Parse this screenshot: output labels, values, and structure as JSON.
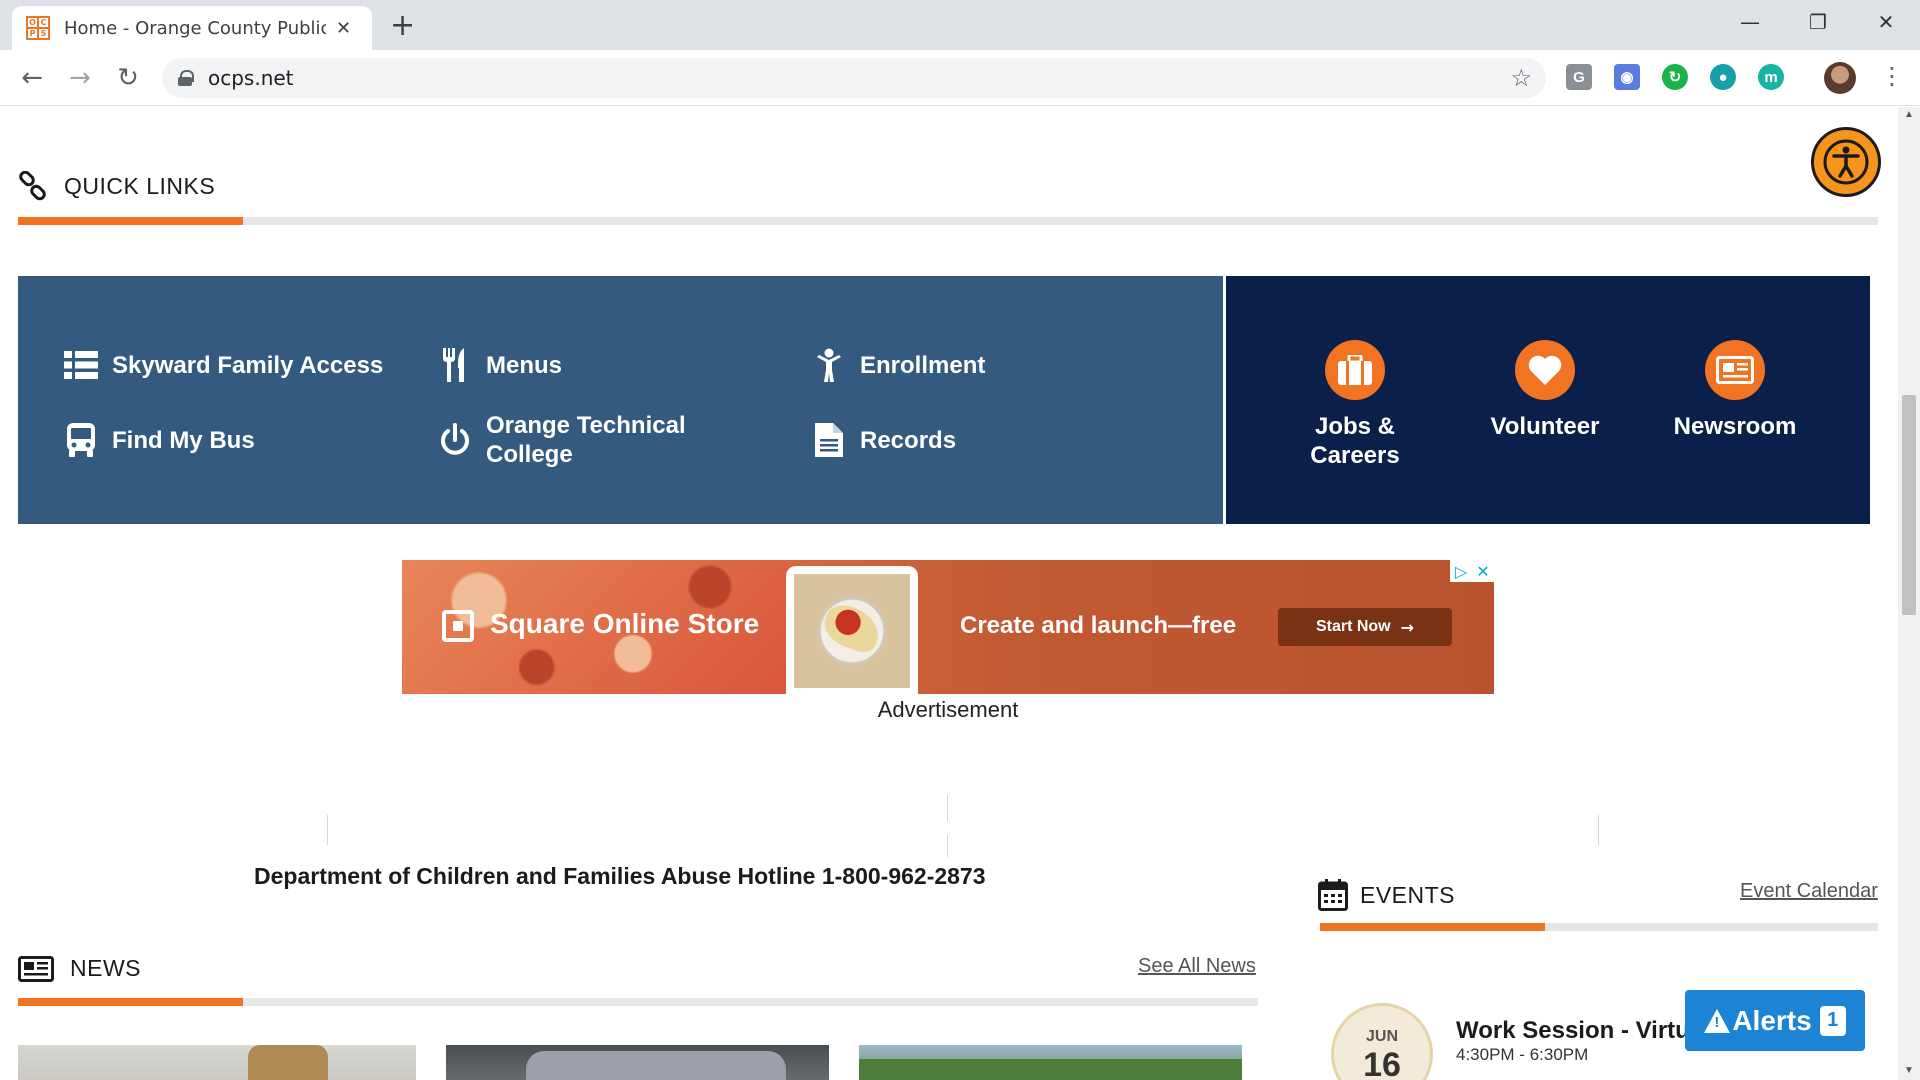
{
  "browser": {
    "tab_title": "Home - Orange County Public Schools",
    "favicon_letters": [
      "O",
      "C",
      "P",
      "S"
    ],
    "url": "ocps.net",
    "window_controls": [
      "minimize",
      "restore",
      "close"
    ],
    "extensions": [
      {
        "name": "grammarly-icon",
        "label": "G",
        "color": "#8a8f96"
      },
      {
        "name": "camera-icon",
        "label": "◉",
        "color": "#5b7be0"
      },
      {
        "name": "sync-icon",
        "label": "↻",
        "color": "#19b24b"
      },
      {
        "name": "blocker-icon",
        "label": "●",
        "color": "#16a0a8"
      },
      {
        "name": "m-icon",
        "label": "m",
        "color": "#17b3a3"
      }
    ]
  },
  "quick_links": {
    "title": "QUICK LINKS",
    "items": [
      {
        "label": "Skyward Family Access",
        "icon": "list-icon"
      },
      {
        "label": "Menus",
        "icon": "utensils-icon"
      },
      {
        "label": "Enrollment",
        "icon": "child-icon"
      },
      {
        "label": "Find My Bus",
        "icon": "bus-icon"
      },
      {
        "label": "Orange Technical College",
        "icon": "power-icon"
      },
      {
        "label": "Records",
        "icon": "document-icon"
      }
    ],
    "featured": [
      {
        "label": "Jobs & Careers",
        "icon": "briefcase-icon"
      },
      {
        "label": "Volunteer",
        "icon": "heart-icon"
      },
      {
        "label": "Newsroom",
        "icon": "newspaper-icon"
      }
    ]
  },
  "ad": {
    "brand": "Square Online Store",
    "tagline": "Create and launch—free",
    "cta": "Start Now",
    "caption": "Advertisement"
  },
  "hotline": "Department of Children and Families Abuse Hotline 1-800-962-2873",
  "news": {
    "title": "NEWS",
    "see_all": "See All News"
  },
  "events": {
    "title": "EVENTS",
    "calendar_link": "Event Calendar",
    "items": [
      {
        "month": "JUN",
        "day": "16",
        "title": "Work Session - Virtual",
        "time": "4:30PM - 6:30PM"
      }
    ]
  },
  "alerts": {
    "label": "Alerts",
    "count": "1"
  },
  "colors": {
    "accent": "#f27321",
    "quick_links_bg": "#345a7f",
    "featured_bg": "#0b1f4b",
    "alerts_bg": "#1d83d4"
  }
}
